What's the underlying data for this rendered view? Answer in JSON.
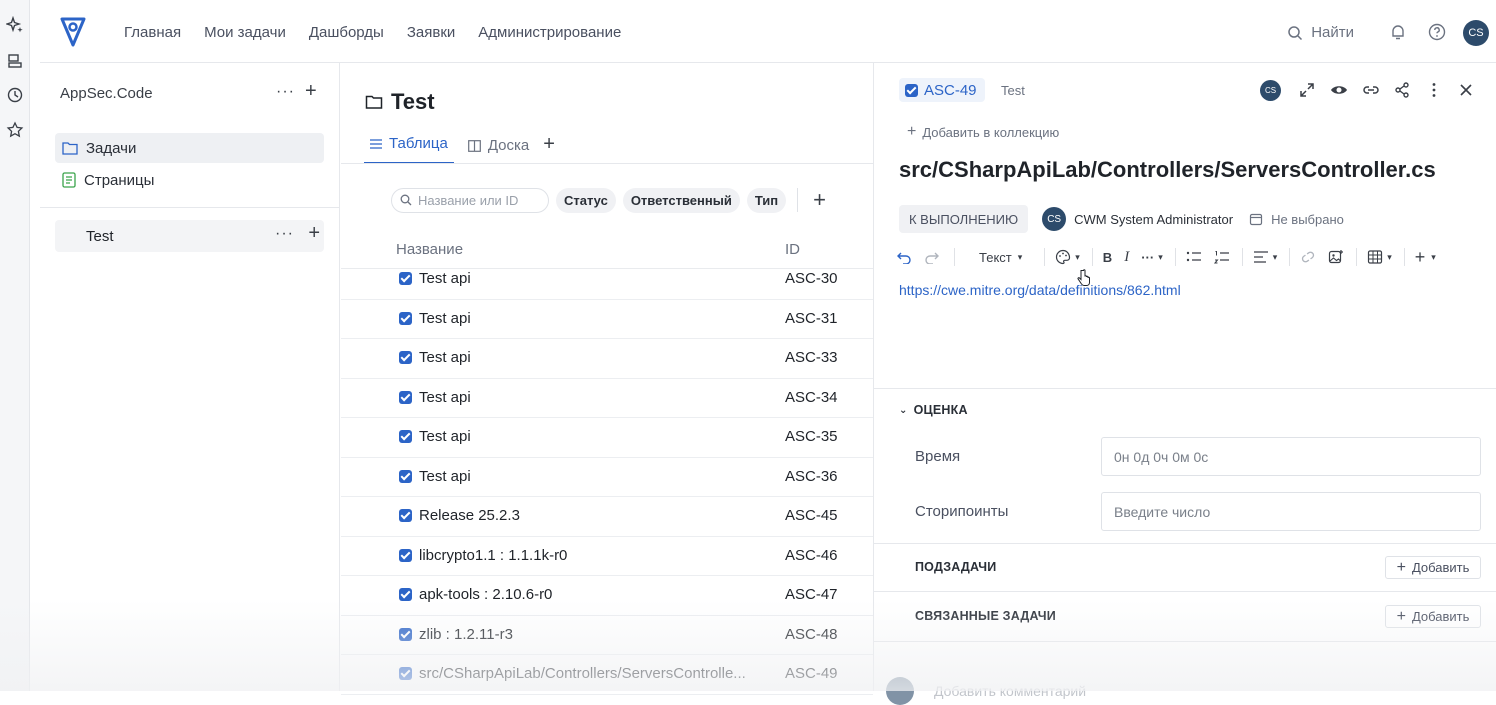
{
  "nav": {
    "items": [
      "Главная",
      "Мои задачи",
      "Дашборды",
      "Заявки",
      "Администрирование"
    ],
    "search_label": "Найти",
    "user_initials": "CS"
  },
  "sidebar": {
    "workspace": "AppSec.Code",
    "items": [
      {
        "label": "Задачи",
        "icon": "folder-icon"
      },
      {
        "label": "Страницы",
        "icon": "page-icon"
      }
    ],
    "project": "Test"
  },
  "list": {
    "title": "Test",
    "tabs": [
      "Таблица",
      "Доска"
    ],
    "search_placeholder": "Название или ID",
    "filters": [
      "Статус",
      "Ответственный",
      "Тип"
    ],
    "columns": [
      "Название",
      "ID"
    ],
    "rows": [
      {
        "name": "Test api",
        "id": "ASC-30"
      },
      {
        "name": "Test api",
        "id": "ASC-31"
      },
      {
        "name": "Test api",
        "id": "ASC-33"
      },
      {
        "name": "Test api",
        "id": "ASC-34"
      },
      {
        "name": "Test api",
        "id": "ASC-35"
      },
      {
        "name": "Test api",
        "id": "ASC-36"
      },
      {
        "name": "Release 25.2.3",
        "id": "ASC-45"
      },
      {
        "name": "libcrypto1.1 : 1.1.1k-r0",
        "id": "ASC-46"
      },
      {
        "name": "apk-tools : 2.10.6-r0",
        "id": "ASC-47"
      },
      {
        "name": "zlib : 1.2.11-r3",
        "id": "ASC-48"
      },
      {
        "name": "src/CSharpApiLab/Controllers/ServersControlle...",
        "id": "ASC-49"
      }
    ]
  },
  "detail": {
    "key": "ASC-49",
    "project": "Test",
    "avatar_initials": "CS",
    "add_collection": "Добавить в коллекцию",
    "title": "src/CSharpApiLab/Controllers/ServersController.cs",
    "status": "К ВЫПОЛНЕНИЮ",
    "assignee": "CWM System Administrator",
    "assignee_initials": "CS",
    "due": "Не выбрано",
    "toolbar_text_style": "Текст",
    "description_link": "https://cwe.mitre.org/data/definitions/862.html",
    "estimate_section": "ОЦЕНКА",
    "time_label": "Время",
    "time_placeholder": "0н 0д 0ч 0м 0с",
    "points_label": "Сторипоинты",
    "points_placeholder": "Введите число",
    "subtasks_section": "ПОДЗАДАЧИ",
    "related_section": "СВЯЗАННЫЕ ЗАДАЧИ",
    "add_label": "Добавить",
    "comment_placeholder": "Добавить комментарий"
  },
  "colors": {
    "accent": "#2c64c7",
    "avatar": "#2d4b6b"
  }
}
